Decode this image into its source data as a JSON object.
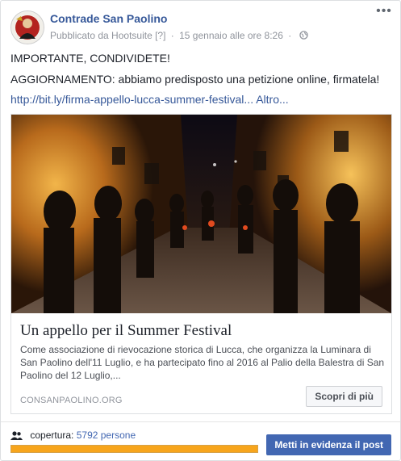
{
  "post": {
    "page_name": "Contrade San Paolino",
    "published_via": "Pubblicato da Hootsuite",
    "info_mark": "[?]",
    "separator": "·",
    "date": "15 gennaio alle ore 8:26",
    "audience_icon": "globe-icon",
    "more_icon": "ellipsis-icon",
    "line1": "IMPORTANTE, CONDIVIDETE!",
    "line2": "AGGIORNAMENTO: abbiamo predisposto una petizione online, firmatela!",
    "link_text": "http://bit.ly/firma-appello-lucca-summer-festival...",
    "more_text": "Altro..."
  },
  "preview": {
    "title": "Un appello per il Summer Festival",
    "description": "Come associazione di rievocazione storica di Lucca, che organizza la Luminara di San Paolino dell'11 Luglio, e ha partecipato fino al 2016 al Palio della Balestra di San Paolino del 12 Luglio,...",
    "domain": "CONSANPAOLINO.ORG",
    "button_label": "Scopri di più"
  },
  "footer": {
    "reach_label": "copertura:",
    "reach_value": "5792 persone",
    "reach_fraction": 1.0,
    "boost_label": "Metti in evidenza il post",
    "reach_color": "#f7a51c",
    "accent_color": "#4267b2"
  }
}
